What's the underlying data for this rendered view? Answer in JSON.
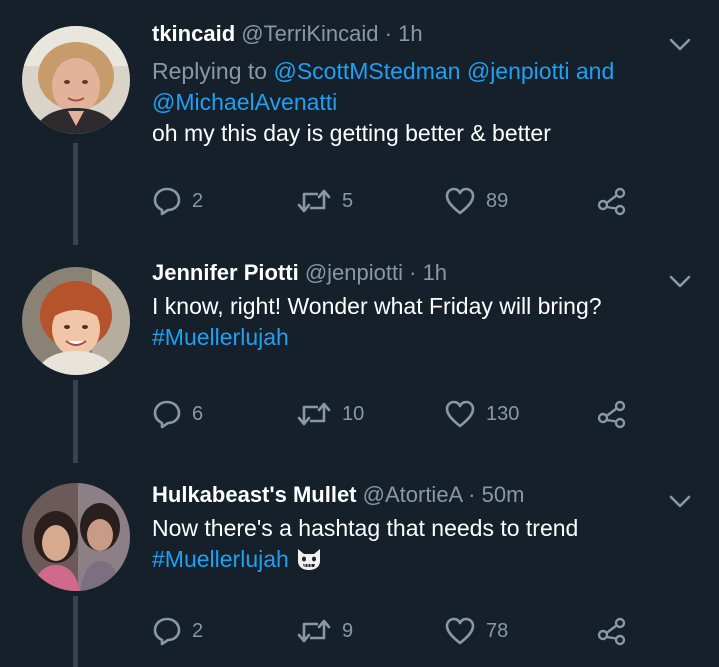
{
  "tweets": [
    {
      "name": "tkincaid",
      "handle": "@TerriKincaid",
      "sep": "·",
      "time": "1h",
      "replying_prefix": "Replying to",
      "replying_mentions": [
        "@ScottMStedman",
        "@jenpiotti",
        "@MichaelAvenatti"
      ],
      "replying_and": "and",
      "text": "oh my this day is getting better & better",
      "hashtag": "",
      "replies": "2",
      "retweets": "5",
      "likes": "89"
    },
    {
      "name": "Jennifer Piotti",
      "handle": "@jenpiotti",
      "sep": "·",
      "time": "1h",
      "text": "I know, right! Wonder what Friday will bring?",
      "hashtag": "#Muellerlujah",
      "replies": "6",
      "retweets": "10",
      "likes": "130"
    },
    {
      "name": "Hulkabeast's Mullet",
      "handle": "@AtortieA",
      "sep": "·",
      "time": "50m",
      "text": "Now there's a hashtag that needs to trend",
      "hashtag": "#Muellerlujah",
      "emoji": "cat-face-emoji",
      "replies": "2",
      "retweets": "9",
      "likes": "78"
    }
  ],
  "colors": {
    "background": "#15202b",
    "text": "#ffffff",
    "secondary": "#8899a6",
    "link": "#1da1f2",
    "thread_line": "#38444d"
  },
  "icons": [
    "reply-icon",
    "retweet-icon",
    "like-icon",
    "share-icon",
    "chevron-down-icon"
  ]
}
